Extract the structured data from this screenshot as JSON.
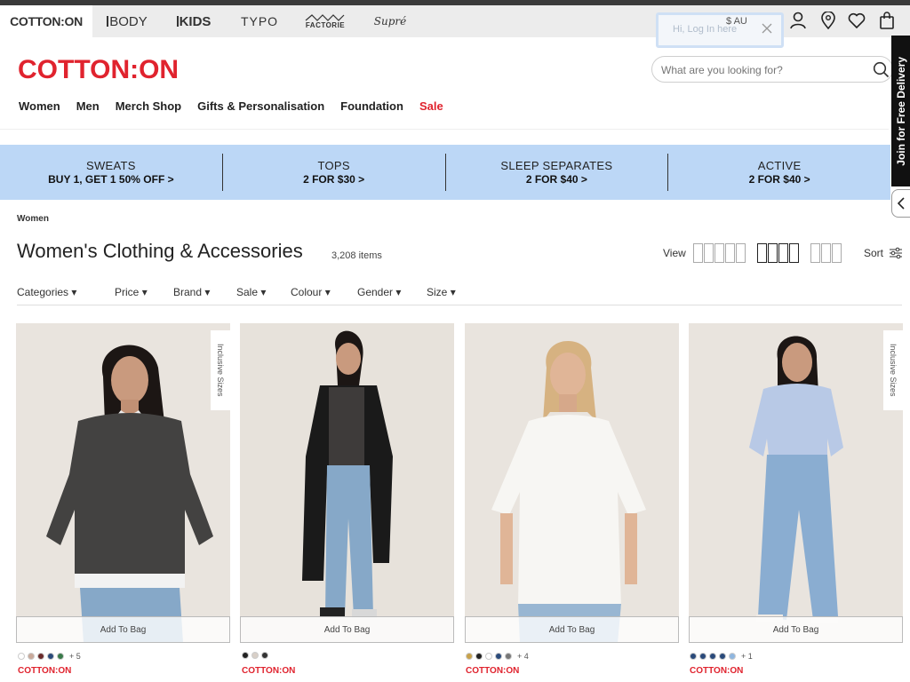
{
  "brands": [
    "COTTON:ON",
    "BODY",
    "KIDS",
    "TYPO",
    "FACTORIE",
    "Supré"
  ],
  "login_hint": "Hi, Log In here",
  "currency": "$ AU",
  "logo": "COTTON:ON",
  "search": {
    "placeholder": "What are you looking for?"
  },
  "nav": [
    "Women",
    "Men",
    "Merch Shop",
    "Gifts & Personalisation",
    "Foundation",
    "Sale"
  ],
  "promos": [
    {
      "title": "SWEATS",
      "offer": "BUY 1, GET 1 50% OFF >"
    },
    {
      "title": "TOPS",
      "offer": "2 FOR $30 >"
    },
    {
      "title": "SLEEP SEPARATES",
      "offer": "2 FOR $40 >"
    },
    {
      "title": "ACTIVE",
      "offer": "2 FOR $40 >"
    }
  ],
  "side_tab": "Join for Free Delivery",
  "breadcrumb": "Women",
  "page_title": "Women's Clothing & Accessories",
  "item_count": "3,208 items",
  "view_label": "View",
  "sort_label": "Sort",
  "filters": [
    "Categories",
    "Price",
    "Brand",
    "Sale",
    "Colour",
    "Gender",
    "Size"
  ],
  "products": [
    {
      "badge": "Inclusive Sizes",
      "add": "Add To Bag",
      "colors": [
        "#ffffff",
        "#c9a99a",
        "#6a2a2a",
        "#2a4a7a",
        "#3a7a4a"
      ],
      "more": "+ 5",
      "brand": "COTTON:ON"
    },
    {
      "badge": "",
      "add": "Add To Bag",
      "colors": [
        "#222222",
        "#d8cfc7",
        "#333333"
      ],
      "more": "",
      "brand": "COTTON:ON"
    },
    {
      "badge": "",
      "add": "Add To Bag",
      "colors": [
        "#c8a24a",
        "#222222",
        "#ffffff",
        "#2a4a7a",
        "#777777"
      ],
      "more": "+ 4",
      "brand": "COTTON:ON"
    },
    {
      "badge": "Inclusive Sizes",
      "add": "Add To Bag",
      "colors": [
        "#2a4a7a",
        "#2a4a7a",
        "#2a4a7a",
        "#2a4a7a",
        "#8fb6df"
      ],
      "more": "+ 1",
      "brand": "COTTON:ON"
    }
  ]
}
